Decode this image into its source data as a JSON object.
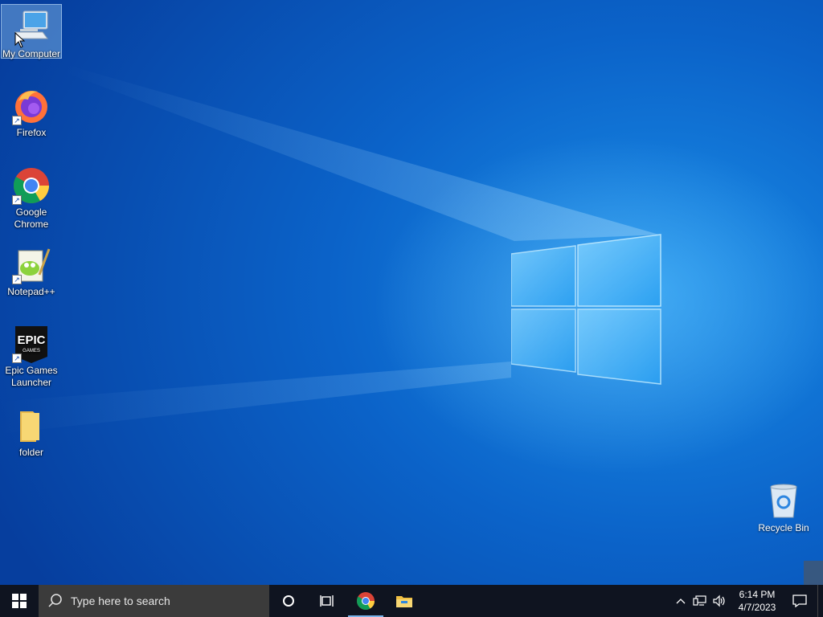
{
  "desktop_icons": [
    {
      "label": "My Computer",
      "icon": "computer-icon",
      "selected": true
    },
    {
      "label": "Firefox",
      "icon": "firefox-icon"
    },
    {
      "label": "Google Chrome",
      "icon": "chrome-icon"
    },
    {
      "label": "Notepad++",
      "icon": "notepadpp-icon"
    },
    {
      "label": "Epic Games Launcher",
      "icon": "epic-games-icon"
    },
    {
      "label": "folder",
      "icon": "folder-icon"
    }
  ],
  "recycle_bin": {
    "label": "Recycle Bin",
    "icon": "recycle-bin-icon"
  },
  "epic_logo_text": {
    "line1": "EPIC",
    "line2": "GAMES"
  },
  "taskbar": {
    "search_placeholder": "Type here to search",
    "pinned": [
      {
        "name": "cortana-button",
        "icon": "circle-icon"
      },
      {
        "name": "task-view-button",
        "icon": "task-view-icon"
      },
      {
        "name": "chrome-taskbar-button",
        "icon": "chrome-icon",
        "active": true
      },
      {
        "name": "file-explorer-taskbar-button",
        "icon": "file-explorer-icon"
      }
    ],
    "clock": {
      "time": "6:14 PM",
      "date": "4/7/2023"
    }
  },
  "colors": {
    "desktop_blue": "#0b63c9",
    "taskbar": "#0f1420",
    "search_box": "#3b3b3b"
  }
}
